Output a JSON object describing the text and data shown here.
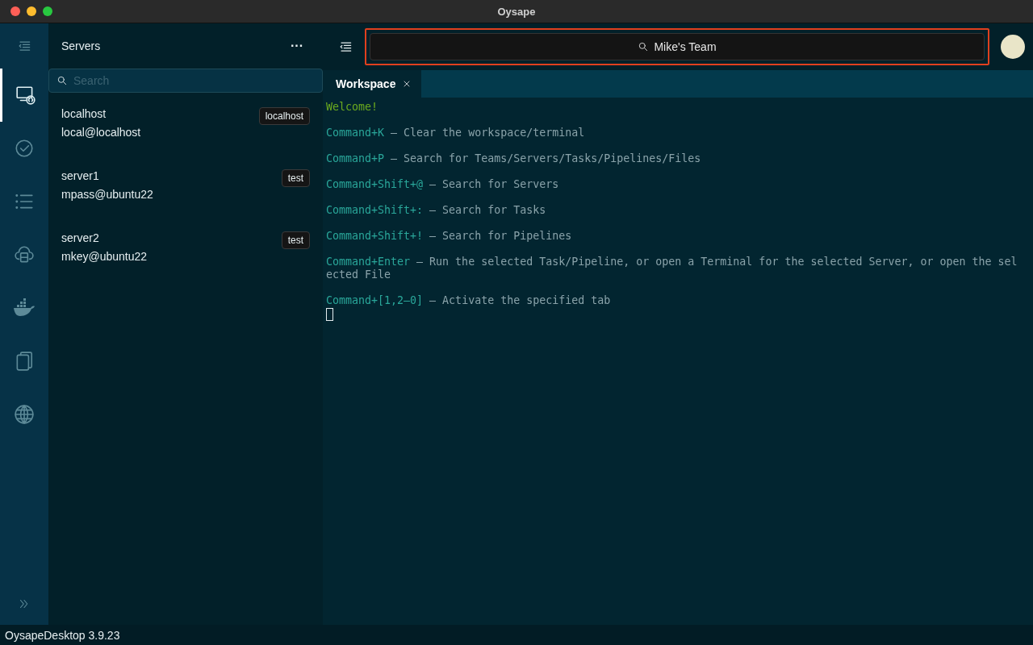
{
  "window": {
    "title": "Oysape"
  },
  "rail": {
    "items": [
      {
        "kind": "servers",
        "selected": true
      },
      {
        "kind": "tasks",
        "selected": false
      },
      {
        "kind": "pipelines",
        "selected": false
      },
      {
        "kind": "cloud",
        "selected": false
      },
      {
        "kind": "docker",
        "selected": false
      },
      {
        "kind": "files",
        "selected": false
      },
      {
        "kind": "globe",
        "selected": false
      }
    ]
  },
  "panel": {
    "title": "Servers",
    "menu": "···",
    "search": {
      "placeholder": "Search"
    },
    "servers": [
      {
        "name": "localhost",
        "user": "local@localhost",
        "tag": "localhost"
      },
      {
        "name": "server1",
        "user": "mpass@ubuntu22",
        "tag": "test"
      },
      {
        "name": "server2",
        "user": "mkey@ubuntu22",
        "tag": "test"
      }
    ]
  },
  "team_search": {
    "value": "Mike's Team",
    "highlighted": true
  },
  "tabs": [
    {
      "label": "Workspace",
      "selected": true
    }
  ],
  "terminal": {
    "lines": [
      {
        "kind": "welcome",
        "text": "Welcome!"
      },
      {
        "kind": "shortcut",
        "key": "Command+K",
        "text": " – Clear the workspace/terminal"
      },
      {
        "kind": "shortcut",
        "key": "Command+P",
        "text": " – Search for Teams/Servers/Tasks/Pipelines/Files"
      },
      {
        "kind": "shortcut",
        "key": "Command+Shift+@",
        "text": " – Search for Servers"
      },
      {
        "kind": "shortcut",
        "key": "Command+Shift+:",
        "text": " – Search for Tasks"
      },
      {
        "kind": "shortcut",
        "key": "Command+Shift+!",
        "text": " – Search for Pipelines"
      },
      {
        "kind": "shortcut",
        "key": "Command+Enter",
        "text": " – Run the selected Task/Pipeline, or open a Terminal for the selected Server, or open the sel"
      },
      {
        "kind": "wrap",
        "text": "ected File"
      },
      {
        "kind": "shortcut",
        "key": "Command+[1,2–0]",
        "text": " – Activate the specified tab"
      }
    ],
    "cursor": true
  },
  "footer": {
    "version": "OysapeDesktop 3.9.23"
  }
}
